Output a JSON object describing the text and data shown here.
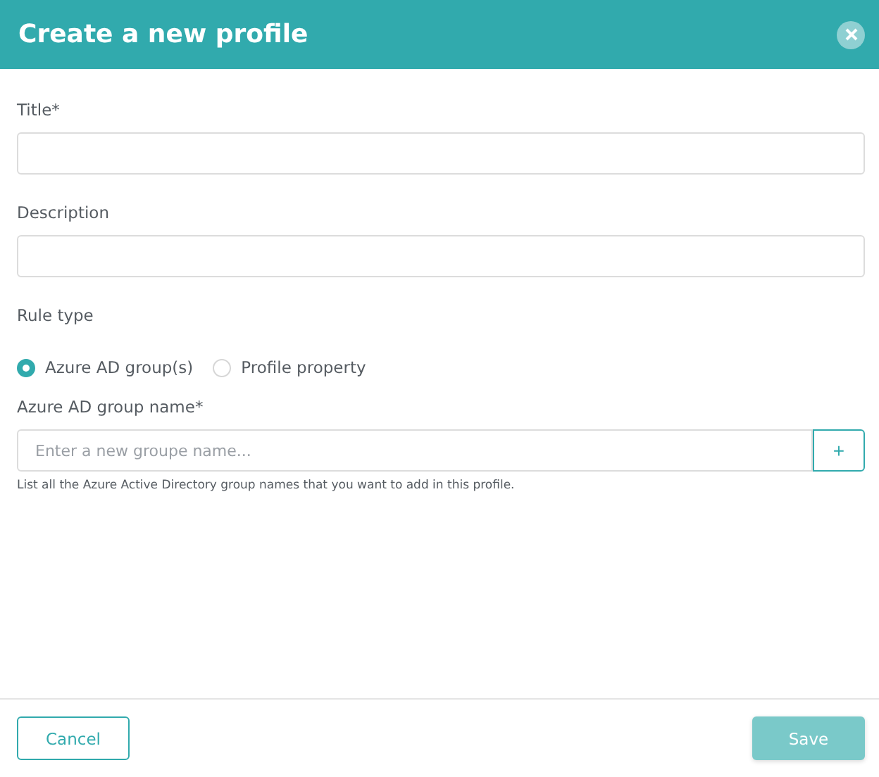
{
  "dialog": {
    "title": "Create a new profile"
  },
  "fields": [
    {
      "label": "Title*"
    },
    {
      "label": "Description"
    }
  ],
  "rule_type": {
    "label": "Rule type",
    "options": [
      {
        "label": "Azure AD group(s)",
        "selected": true
      },
      {
        "label": "Profile property",
        "selected": false
      }
    ]
  },
  "group_name": {
    "label": "Azure AD group name*",
    "placeholder": "Enter a new groupe name...",
    "add_button": "+",
    "help": "List all the Azure Active Directory group names that you want to add in this profile."
  },
  "footer": {
    "cancel": "Cancel",
    "save": {
      "label": "Save",
      "disabled": true
    }
  }
}
